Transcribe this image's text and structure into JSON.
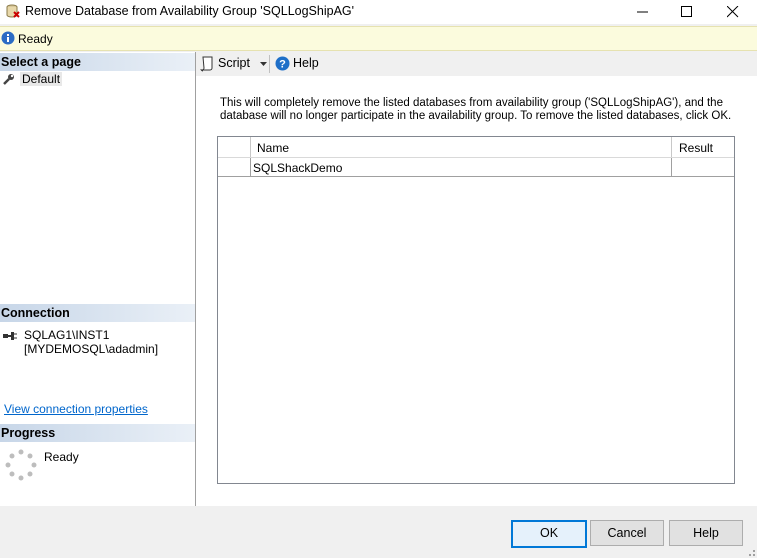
{
  "window": {
    "title": "Remove Database from Availability Group 'SQLLogShipAG'",
    "icons": {
      "app": "database-icon",
      "minimize": "minimize-icon",
      "maximize": "maximize-icon",
      "close": "close-icon"
    }
  },
  "status": {
    "text": "Ready",
    "icon": "info-icon"
  },
  "sidebar": {
    "select_page_header": "Select a page",
    "pages": [
      {
        "label": "Default",
        "icon": "wrench-icon"
      }
    ],
    "connection_header": "Connection",
    "connection_server": "SQLAG1\\INST1",
    "connection_user": "[MYDEMOSQL\\adadmin]",
    "connection_icon": "connection-icon",
    "view_connection_link": "View connection properties",
    "progress_header": "Progress",
    "progress_status": "Ready",
    "progress_icon": "spinner-icon"
  },
  "toolbar": {
    "script_label": "Script",
    "help_label": "Help"
  },
  "main": {
    "description": "This will completely remove the listed databases from availability group ('SQLLogShipAG'), and the database will no longer participate in the availability group. To remove the listed databases, click OK.",
    "table": {
      "columns": [
        "Name",
        "Result"
      ],
      "rows": [
        {
          "name": "SQLShackDemo",
          "result": ""
        }
      ]
    }
  },
  "buttons": {
    "ok": "OK",
    "cancel": "Cancel",
    "help": "Help"
  }
}
